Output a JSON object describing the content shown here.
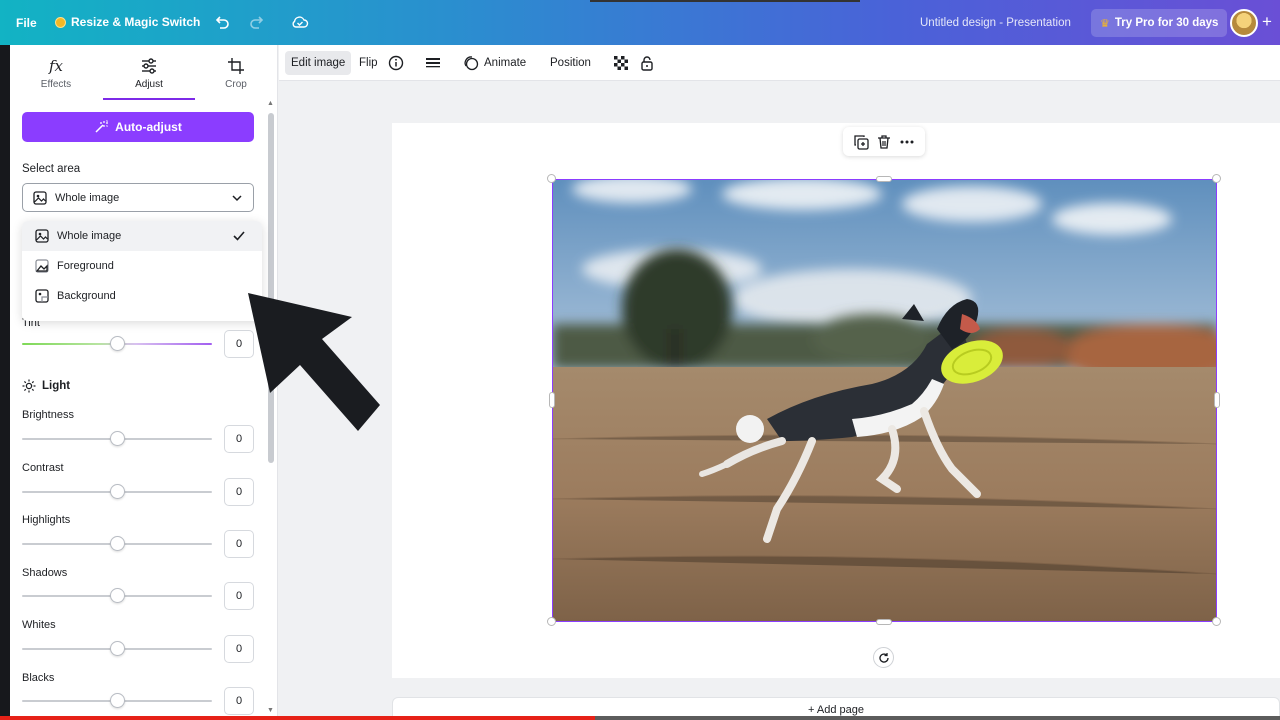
{
  "header": {
    "file_label": "File",
    "resize_label": "Resize & Magic Switch",
    "design_title": "Untitled design - Presentation",
    "pro_label": "Try Pro for 30 days"
  },
  "panel": {
    "tabs": [
      {
        "label": "Effects",
        "icon": "fx-icon"
      },
      {
        "label": "Adjust",
        "icon": "sliders-icon"
      },
      {
        "label": "Crop",
        "icon": "crop-icon"
      }
    ],
    "auto_adjust_label": "Auto-adjust",
    "select_area_label": "Select area",
    "select_value": "Whole image",
    "dropdown_options": [
      "Whole image",
      "Foreground",
      "Background"
    ],
    "tint_label": "Tint",
    "tint_value": "0",
    "light_section": "Light",
    "adjustments": [
      {
        "label": "Brightness",
        "value": "0"
      },
      {
        "label": "Contrast",
        "value": "0"
      },
      {
        "label": "Highlights",
        "value": "0"
      },
      {
        "label": "Shadows",
        "value": "0"
      },
      {
        "label": "Whites",
        "value": "0"
      },
      {
        "label": "Blacks",
        "value": "0"
      }
    ]
  },
  "toolbar": {
    "edit_image": "Edit image",
    "flip": "Flip",
    "animate": "Animate",
    "position": "Position"
  },
  "canvas": {
    "add_page": "+ Add page"
  },
  "video": {
    "progress": 0.465
  }
}
